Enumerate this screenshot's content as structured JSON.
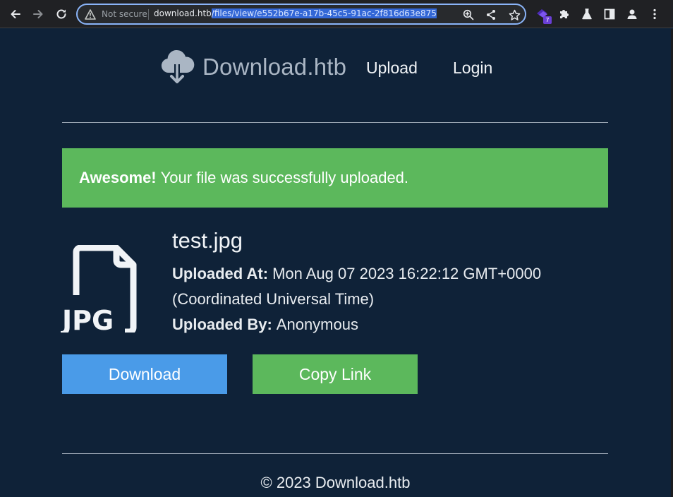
{
  "browser": {
    "security_label": "Not secure",
    "url_host": "download.htb",
    "url_path": "/files/view/e552b67e-a17b-45c5-91ac-2f816d63e875",
    "extension_badge": "7",
    "icons": [
      "back-icon",
      "forward-icon",
      "reload-icon",
      "warning-icon",
      "zoom-icon",
      "share-icon",
      "star-icon",
      "extension-badge-icon",
      "puzzle-icon",
      "labs-icon",
      "sidepanel-icon",
      "profile-icon",
      "menu-icon"
    ]
  },
  "site": {
    "brand": "Download.htb",
    "nav": {
      "upload": "Upload",
      "login": "Login"
    }
  },
  "alert": {
    "strong": "Awesome!",
    "message": "Your file was successfully uploaded.",
    "color": "#5cb85c"
  },
  "file": {
    "name": "test.jpg",
    "type_label": "JPG",
    "uploaded_at_label": "Uploaded At:",
    "uploaded_at_value": "Mon Aug 07 2023 16:22:12 GMT+0000",
    "uploaded_at_tz": "(Coordinated Universal Time)",
    "uploaded_by_label": "Uploaded By:",
    "uploaded_by_value": "Anonymous"
  },
  "actions": {
    "download": "Download",
    "copy_link": "Copy Link",
    "download_color": "#4a9be8",
    "copy_color": "#5cb85c"
  },
  "footer": {
    "text": "© 2023 Download.htb"
  },
  "theme": {
    "background": "#0f2238"
  }
}
